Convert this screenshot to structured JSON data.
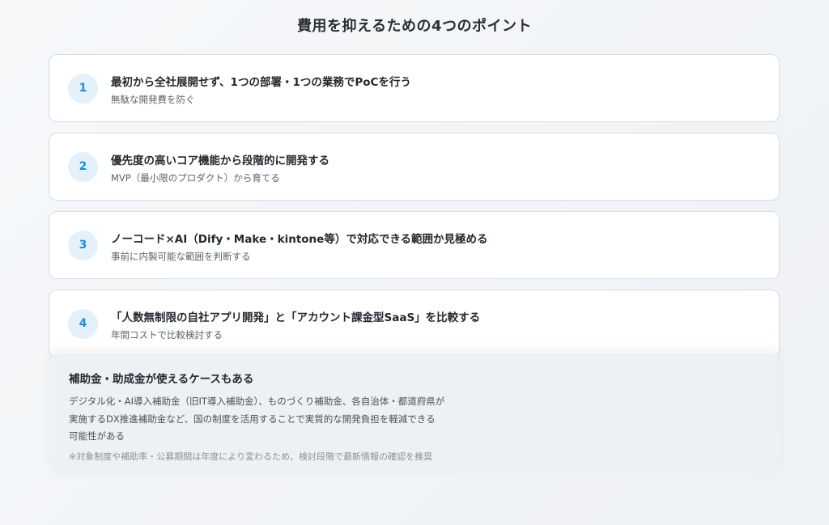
{
  "page": {
    "title": "費用を抑えるための4つのポイント"
  },
  "points": [
    {
      "number": "1",
      "title": "最初から全社展開せず、1つの部署・1つの業務でPoCを行う",
      "subtitle": "無駄な開発費を防ぐ"
    },
    {
      "number": "2",
      "title": "優先度の高いコア機能から段階的に開発する",
      "subtitle": "MVP（最小限のプロダクト）から育てる"
    },
    {
      "number": "3",
      "title": "ノーコード×AI（Dify・Make・kintone等）で対応できる範囲か見極める",
      "subtitle": "事前に内製可能な範囲を判断する"
    },
    {
      "number": "4",
      "title": "「人数無制限の自社アプリ開発」と「アカウント課金型SaaS」を比較する",
      "subtitle": "年間コストで比較検討する"
    }
  ],
  "subsidy": {
    "title": "補助金・助成金が使えるケースもある",
    "lines": [
      "デジタル化・AI導入補助金（旧IT導入補助金）、ものづくり補助金、各自治体・都道府県が",
      "実施するDX推進補助金など、国の制度を活用することで実質的な開発負担を軽減できる",
      "可能性がある"
    ],
    "note": "※対象制度や補助率・公募期間は年度により変わるため、検討段階で最新情報の確認を推奨"
  }
}
